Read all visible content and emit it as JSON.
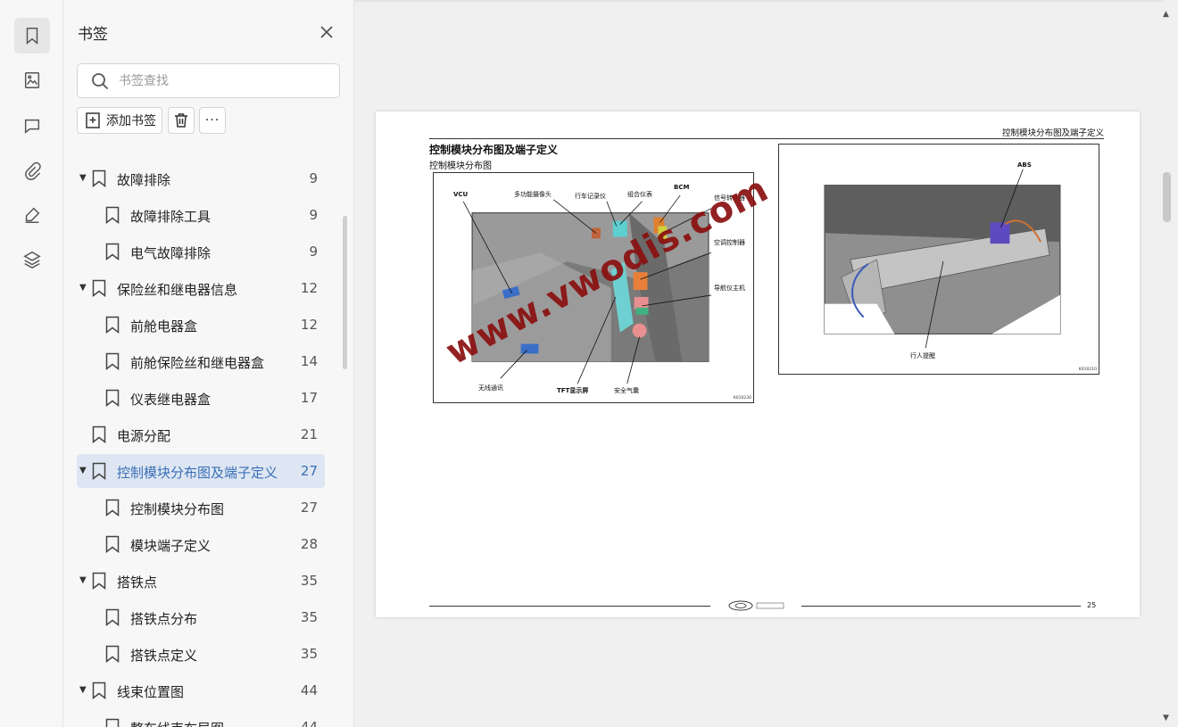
{
  "panel": {
    "title": "书签",
    "search_placeholder": "书签查找",
    "add_label": "添加书签",
    "more_label": "···"
  },
  "bookmarks": [
    {
      "label": "故障排除",
      "page": "9",
      "level": 0,
      "expanded": true
    },
    {
      "label": "故障排除工具",
      "page": "9",
      "level": 1
    },
    {
      "label": "电气故障排除",
      "page": "9",
      "level": 1
    },
    {
      "label": "保险丝和继电器信息",
      "page": "12",
      "level": 0,
      "expanded": true
    },
    {
      "label": "前舱电器盒",
      "page": "12",
      "level": 1
    },
    {
      "label": "前舱保险丝和继电器盒",
      "page": "14",
      "level": 1
    },
    {
      "label": "仪表继电器盒",
      "page": "17",
      "level": 1
    },
    {
      "label": "电源分配",
      "page": "21",
      "level": 0
    },
    {
      "label": "控制模块分布图及端子定义",
      "page": "27",
      "level": 0,
      "expanded": true,
      "active": true
    },
    {
      "label": "控制模块分布图",
      "page": "27",
      "level": 1
    },
    {
      "label": "模块端子定义",
      "page": "28",
      "level": 1
    },
    {
      "label": "搭铁点",
      "page": "35",
      "level": 0,
      "expanded": true
    },
    {
      "label": "搭铁点分布",
      "page": "35",
      "level": 1
    },
    {
      "label": "搭铁点定义",
      "page": "35",
      "level": 1
    },
    {
      "label": "线束位置图",
      "page": "44",
      "level": 0,
      "expanded": true
    },
    {
      "label": "整车线束布局图",
      "page": "44",
      "level": 1
    }
  ],
  "document": {
    "header": "控制模块分布图及端子定义",
    "section_title": "控制模块分布图及端子定义",
    "subsection_title": "控制模块分布图",
    "figure1": {
      "code": "K010230",
      "labels": {
        "vcu": "VCU",
        "camera": "多功能摄像头",
        "recorder": "行车记录仪",
        "cluster": "组合仪表",
        "bcm": "BCM",
        "converter": "信号转化器",
        "ac": "空调控制器",
        "nav": "导航仪主机",
        "wireless": "无线通讯",
        "tft": "TFT显示屏",
        "airbag": "安全气囊"
      }
    },
    "figure2": {
      "code": "K010210",
      "labels": {
        "abs": "ABS",
        "pedestrian": "行人提醒"
      }
    },
    "watermark": "www.vwodis.com",
    "page_number": "25"
  },
  "colors": {
    "accent": "#3a6fb7",
    "active_bg": "#dde6f2",
    "watermark": "#8a1010"
  }
}
